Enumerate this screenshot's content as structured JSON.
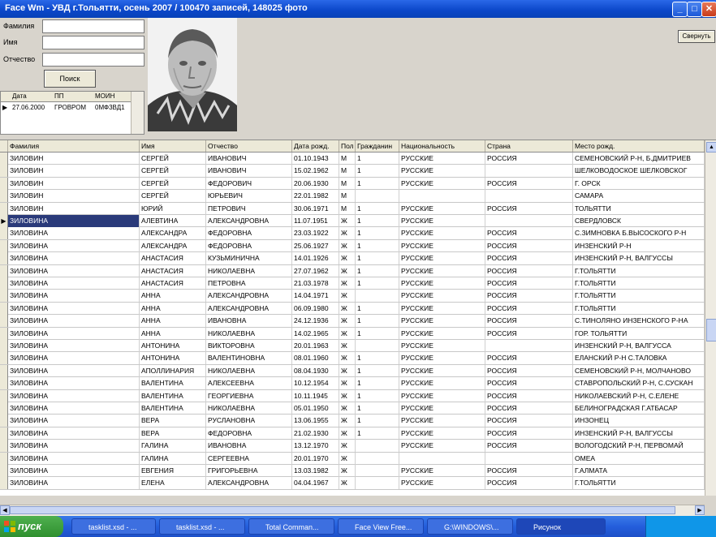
{
  "window": {
    "title": "Face Wm - УВД г.Тольятти, осень 2007 / 100470 записей, 148025 фото",
    "minimize": "_",
    "maximize": "□",
    "close": "✕"
  },
  "search": {
    "surname_label": "Фамилия",
    "name_label": "Имя",
    "patronymic_label": "Отчество",
    "search_button": "Поиск",
    "close_button": "Свернуть"
  },
  "history": {
    "headers": [
      "Дата",
      "ПП",
      "МОИН"
    ],
    "rows": [
      [
        "27.06.2000",
        "ГРОВРОМ",
        "0МФ3ВД1"
      ]
    ]
  },
  "photo": {
    "alt": "person-photo"
  },
  "table": {
    "headers": [
      "Фамилия",
      "Имя",
      "Отчество",
      "Дата рожд.",
      "Пол",
      "Гражданин",
      "Национальность",
      "Страна",
      "Место рожд."
    ],
    "selected_row": 5,
    "rows": [
      [
        "ЗИЛОВИН",
        "СЕРГЕЙ",
        "ИВАНОВИЧ",
        "01.10.1943",
        "М",
        "1",
        "РУССКИЕ",
        "РОССИЯ",
        "СЕМЕНОВСКИЙ Р-Н, Б.ДМИТРИЕВ"
      ],
      [
        "ЗИЛОВИН",
        "СЕРГЕЙ",
        "ИВАНОВИЧ",
        "15.02.1962",
        "М",
        "1",
        "РУССКИЕ",
        "",
        "ШЕЛКОВОДОСКОЕ ШЕЛКОВСКОГ"
      ],
      [
        "ЗИЛОВИН",
        "СЕРГЕЙ",
        "ФЕДОРОВИЧ",
        "20.06.1930",
        "М",
        "1",
        "РУССКИЕ",
        "РОССИЯ",
        "Г. ОРСК"
      ],
      [
        "ЗИЛОВИН",
        "СЕРГЕЙ",
        "ЮРЬЕВИЧ",
        "22.01.1982",
        "М",
        "",
        "",
        "",
        "САМАРА"
      ],
      [
        "ЗИЛОВИН",
        "ЮРИЙ",
        "ПЕТРОВИЧ",
        "30.06.1971",
        "М",
        "1",
        "РУССКИЕ",
        "РОССИЯ",
        "ТОЛЬЯТТИ"
      ],
      [
        "ЗИЛОВИНА",
        "АЛЕВТИНА",
        "АЛЕКСАНДРОВНА",
        "11.07.1951",
        "Ж",
        "1",
        "РУССКИЕ",
        "",
        "СВЕРДЛОВСК"
      ],
      [
        "ЗИЛОВИНА",
        "АЛЕКСАНДРА",
        "ФЕДОРОВНА",
        "23.03.1922",
        "Ж",
        "1",
        "РУССКИЕ",
        "РОССИЯ",
        "С.ЗИМНОВКА Б.ВЫСОСКОГО Р-Н"
      ],
      [
        "ЗИЛОВИНА",
        "АЛЕКСАНДРА",
        "ФЕДОРОВНА",
        "25.06.1927",
        "Ж",
        "1",
        "РУССКИЕ",
        "РОССИЯ",
        "ИНЗЕНСКИЙ Р-Н"
      ],
      [
        "ЗИЛОВИНА",
        "АНАСТАСИЯ",
        "КУЗЬМИНИЧНА",
        "14.01.1926",
        "Ж",
        "1",
        "РУССКИЕ",
        "РОССИЯ",
        "ИНЗЕНСКИЙ Р-Н, ВАЛГУССЫ"
      ],
      [
        "ЗИЛОВИНА",
        "АНАСТАСИЯ",
        "НИКОЛАЕВНА",
        "27.07.1962",
        "Ж",
        "1",
        "РУССКИЕ",
        "РОССИЯ",
        "Г.ТОЛЬЯТТИ"
      ],
      [
        "ЗИЛОВИНА",
        "АНАСТАСИЯ",
        "ПЕТРОВНА",
        "21.03.1978",
        "Ж",
        "1",
        "РУССКИЕ",
        "РОССИЯ",
        "Г.ТОЛЬЯТТИ"
      ],
      [
        "ЗИЛОВИНА",
        "АННА",
        "АЛЕКСАНДРОВНА",
        "14.04.1971",
        "Ж",
        "",
        "РУССКИЕ",
        "РОССИЯ",
        "Г.ТОЛЬЯТТИ"
      ],
      [
        "ЗИЛОВИНА",
        "АННА",
        "АЛЕКСАНДРОВНА",
        "06.09.1980",
        "Ж",
        "1",
        "РУССКИЕ",
        "РОССИЯ",
        "Г.ТОЛЬЯТТИ"
      ],
      [
        "ЗИЛОВИНА",
        "АННА",
        "ИВАНОВНА",
        "24.12.1936",
        "Ж",
        "1",
        "РУССКИЕ",
        "РОССИЯ",
        "С.ТИНОЛЯНО ИНЗЕНСКОГО Р-НА"
      ],
      [
        "ЗИЛОВИНА",
        "АННА",
        "НИКОЛАЕВНА",
        "14.02.1965",
        "Ж",
        "1",
        "РУССКИЕ",
        "РОССИЯ",
        "ГОР. ТОЛЬЯТТИ"
      ],
      [
        "ЗИЛОВИНА",
        "АНТОНИНА",
        "ВИКТОРОВНА",
        "20.01.1963",
        "Ж",
        "",
        "РУССКИЕ",
        "",
        "ИНЗЕНСКИЙ Р-Н, ВАЛГУССА"
      ],
      [
        "ЗИЛОВИНА",
        "АНТОНИНА",
        "ВАЛЕНТИНОВНА",
        "08.01.1960",
        "Ж",
        "1",
        "РУССКИЕ",
        "РОССИЯ",
        "ЕЛАНСКИЙ Р-Н С.ТАЛОВКА"
      ],
      [
        "ЗИЛОВИНА",
        "АПОЛЛИНАРИЯ",
        "НИКОЛАЕВНА",
        "08.04.1930",
        "Ж",
        "1",
        "РУССКИЕ",
        "РОССИЯ",
        "СЕМЕНОВСКИЙ Р-Н, МОЛЧАНОВО"
      ],
      [
        "ЗИЛОВИНА",
        "ВАЛЕНТИНА",
        "АЛЕКСЕЕВНА",
        "10.12.1954",
        "Ж",
        "1",
        "РУССКИЕ",
        "РОССИЯ",
        "СТАВРОПОЛЬСКИЙ Р-Н, С.СУСКАН"
      ],
      [
        "ЗИЛОВИНА",
        "ВАЛЕНТИНА",
        "ГЕОРГИЕВНА",
        "10.11.1945",
        "Ж",
        "1",
        "РУССКИЕ",
        "РОССИЯ",
        "НИКОЛАЕВСКИЙ Р-Н, С.ЕЛЕНЕ"
      ],
      [
        "ЗИЛОВИНА",
        "ВАЛЕНТИНА",
        "НИКОЛАЕВНА",
        "05.01.1950",
        "Ж",
        "1",
        "РУССКИЕ",
        "РОССИЯ",
        "БЕЛИНОГРАДСКАЯ Г.АТБАСАР"
      ],
      [
        "ЗИЛОВИНА",
        "ВЕРА",
        "РУСЛАНОВНА",
        "13.06.1955",
        "Ж",
        "1",
        "РУССКИЕ",
        "РОССИЯ",
        "ИНЗОНЕЦ"
      ],
      [
        "ЗИЛОВИНА",
        "ВЕРА",
        "ФЕДОРОВНА",
        "21.02.1930",
        "Ж",
        "1",
        "РУССКИЕ",
        "РОССИЯ",
        "ИНЗЕНСКИЙ Р-Н, ВАЛГУССЫ"
      ],
      [
        "ЗИЛОВИНА",
        "ГАЛИНА",
        "ИВАНОВНА",
        "13.12.1970",
        "Ж",
        "",
        "РУССКИЕ",
        "РОССИЯ",
        "ВОЛОГОДСКИЙ Р-Н, ПЕРВОМАЙ"
      ],
      [
        "ЗИЛОВИНА",
        "ГАЛИНА",
        "СЕРГЕЕВНА",
        "20.01.1970",
        "Ж",
        "",
        "",
        "",
        "ОМЕА"
      ],
      [
        "ЗИЛОВИНА",
        "ЕВГЕНИЯ",
        "ГРИГОРЬЕВНА",
        "13.03.1982",
        "Ж",
        "",
        "РУССКИЕ",
        "РОССИЯ",
        "Г.АЛМАТА"
      ],
      [
        "ЗИЛОВИНА",
        "ЕЛЕНА",
        "АЛЕКСАНДРОВНА",
        "04.04.1967",
        "Ж",
        "",
        "РУССКИЕ",
        "РОССИЯ",
        "Г.ТОЛЬЯТТИ"
      ]
    ]
  },
  "taskbar": {
    "start_label": "пуск",
    "tasks": [
      "tasklist.xsd - ...",
      "tasklist.xsd - ...",
      "Total Comman...",
      "Face View Free...",
      "G:\\WINDOWS\\...",
      "Рисунок"
    ],
    "active_task": 5
  }
}
